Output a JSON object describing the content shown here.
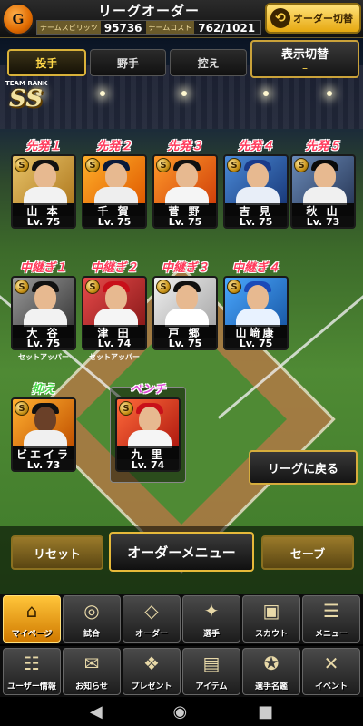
{
  "header": {
    "team_logo_letter": "G",
    "title": "リーグオーダー",
    "spirit_label": "チームスピリッツ",
    "spirit_value": "95736",
    "cost_label": "チームコスト",
    "cost_value": "762/1021",
    "order_switch_label": "オーダー切替",
    "order_switch_icon": "swap-arrows-icon"
  },
  "tabs": [
    {
      "label": "投手",
      "active": true
    },
    {
      "label": "野手",
      "active": false
    },
    {
      "label": "控え",
      "active": false
    }
  ],
  "display_switch": {
    "label": "表示切替",
    "value": "–"
  },
  "team_rank": {
    "label": "TEAM RANK",
    "value": "SS"
  },
  "starters": [
    {
      "slot": "先発１",
      "name": "山 本",
      "lv": "Lv. 75",
      "badge": "S"
    },
    {
      "slot": "先発２",
      "name": "千 賀",
      "lv": "Lv. 75",
      "badge": "S"
    },
    {
      "slot": "先発３",
      "name": "菅 野",
      "lv": "Lv. 75",
      "badge": "S"
    },
    {
      "slot": "先発４",
      "name": "吉 見",
      "lv": "Lv. 75",
      "badge": "S"
    },
    {
      "slot": "先発５",
      "name": "秋 山",
      "lv": "Lv. 73",
      "badge": "S"
    }
  ],
  "relievers": [
    {
      "slot": "中継ぎ１",
      "name": "大 谷",
      "lv": "Lv. 75",
      "badge": "S",
      "role": "セットアッパー"
    },
    {
      "slot": "中継ぎ２",
      "name": "津 田",
      "lv": "Lv. 74",
      "badge": "S",
      "role": "セットアッパー"
    },
    {
      "slot": "中継ぎ３",
      "name": "戸 郷",
      "lv": "Lv. 75",
      "badge": "S",
      "role": ""
    },
    {
      "slot": "中継ぎ４",
      "name": "山﨑康",
      "lv": "Lv. 75",
      "badge": "S",
      "role": ""
    }
  ],
  "closer": {
    "slot": "抑え",
    "name": "ビエイラ",
    "lv": "Lv. 73",
    "badge": "S"
  },
  "bench": {
    "slot": "ベンチ",
    "name": "九 里",
    "lv": "Lv. 74",
    "badge": "S"
  },
  "buttons": {
    "back_to_league": "リーグに戻る",
    "reset": "リセット",
    "order_menu": "オーダーメニュー",
    "save": "セーブ"
  },
  "nav_top": [
    {
      "label": "マイページ",
      "icon": "home-icon",
      "glyph": "⌂",
      "active": true
    },
    {
      "label": "試合",
      "icon": "stadium-icon",
      "glyph": "◎",
      "active": false
    },
    {
      "label": "オーダー",
      "icon": "diamond-icon",
      "glyph": "◇",
      "active": false
    },
    {
      "label": "選手",
      "icon": "player-icon",
      "glyph": "✦",
      "active": false
    },
    {
      "label": "スカウト",
      "icon": "scout-card-icon",
      "glyph": "▣",
      "active": false
    },
    {
      "label": "メニュー",
      "icon": "menu-icon",
      "glyph": "☰",
      "active": false
    }
  ],
  "nav_bottom": [
    {
      "label": "ユーザー情報",
      "icon": "user-info-icon",
      "glyph": "☷"
    },
    {
      "label": "お知らせ",
      "icon": "notice-icon",
      "glyph": "✉"
    },
    {
      "label": "プレゼント",
      "icon": "gift-icon",
      "glyph": "❖"
    },
    {
      "label": "アイテム",
      "icon": "item-book-icon",
      "glyph": "▤"
    },
    {
      "label": "選手名鑑",
      "icon": "player-guide-icon",
      "glyph": "✪"
    },
    {
      "label": "イベント",
      "icon": "event-bat-icon",
      "glyph": "✕"
    }
  ],
  "colors": {
    "slot_label": "#ff3b5c",
    "gold_border": "#d9b23a",
    "active_tab_text": "#ffd84a"
  }
}
